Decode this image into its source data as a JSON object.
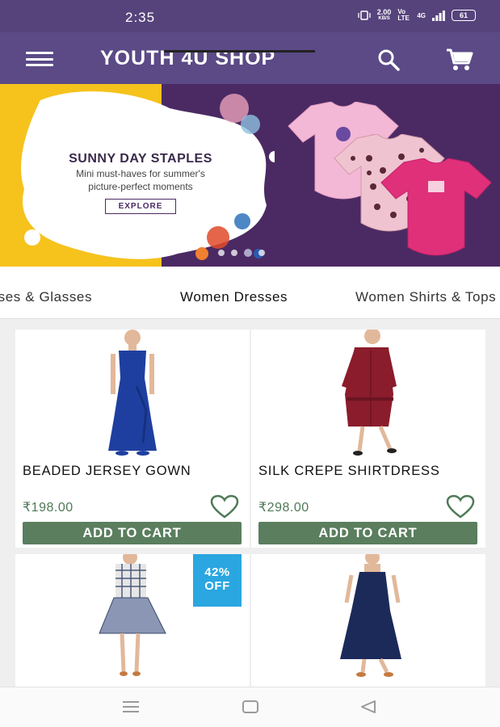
{
  "status": {
    "time": "2:35",
    "net_speed_value": "2.00",
    "net_speed_unit": "KB/S",
    "volte": "Vo LTE",
    "network": "4G",
    "battery": "61"
  },
  "app_bar": {
    "title": "YOUTH 4U SHOP",
    "menu_icon": "hamburger-menu-icon",
    "search_icon": "search-icon",
    "cart_icon": "shopping-cart-icon"
  },
  "banner": {
    "heading": "SUNNY DAY STAPLES",
    "subtitle_line1": "Mini must-haves for summer's",
    "subtitle_line2": "picture-perfect moments",
    "button_label": "EXPLORE",
    "slide_count": 5,
    "active_slide": 3
  },
  "tabs": {
    "items": [
      {
        "label": "Sunglasses & Glasses",
        "active": false
      },
      {
        "label": "Women Dresses",
        "active": true
      },
      {
        "label": "Women Shirts & Tops",
        "active": false
      }
    ]
  },
  "products": [
    {
      "name": "BEADED JERSEY GOWN",
      "price": "₹198.00",
      "button": "ADD TO CART",
      "dress_color": "#1f3fa0"
    },
    {
      "name": "SILK CREPE SHIRTDRESS",
      "price": "₹298.00",
      "button": "ADD TO CART",
      "dress_color": "#8a1c2c"
    },
    {
      "name": "",
      "price": "",
      "button": "",
      "discount_line1": "42%",
      "discount_line2": "OFF",
      "dress_color": "#5a6a8a"
    },
    {
      "name": "",
      "price": "",
      "button": "",
      "dress_color": "#1c2a5a"
    }
  ],
  "colors": {
    "status_bar": "#56437c",
    "app_bar": "#5b4a86",
    "price_green": "#4f7a58",
    "button_green": "#5a7e5e",
    "badge_blue": "#2aa6e0"
  },
  "nav": {
    "recents_icon": "recents-icon",
    "home_icon": "home-icon",
    "back_icon": "back-icon"
  }
}
